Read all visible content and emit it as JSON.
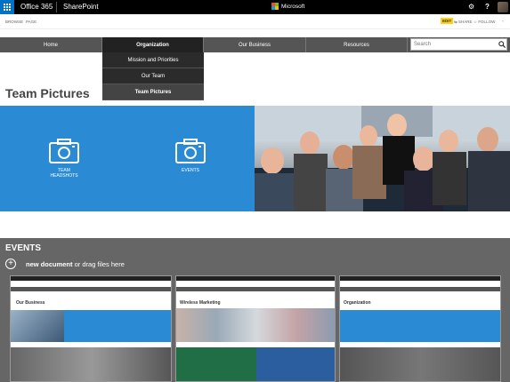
{
  "suite": {
    "app": "Office 365",
    "site": "SharePoint",
    "brand": "Microsoft"
  },
  "ribbon": {
    "browse": "BROWSE",
    "page": "PAGE",
    "edit": "EDIT",
    "share": "SHARE",
    "follow": "FOLLOW"
  },
  "nav": {
    "items": [
      "Home",
      "Organization",
      "Our Business",
      "Resources"
    ],
    "search_placeholder": "Search"
  },
  "dropdown": [
    "Mission and Priorities",
    "Our Team",
    "Team Pictures"
  ],
  "page_title": "Team Pictures",
  "tiles": [
    {
      "label_line1": "TEAM",
      "label_line2": "HEADSHOTS"
    },
    {
      "label_line1": "EVENTS",
      "label_line2": ""
    }
  ],
  "events": {
    "title": "EVENTS",
    "new_document": "new document",
    "drag_text": "or drag files here"
  },
  "thumbnails": {
    "t1_heading": "Our Business",
    "t2_heading": "Wireless Marketing",
    "t3_heading": "Organization"
  },
  "colors": {
    "accent": "#2a8ad4",
    "nav": "#555555",
    "edit": "#fcd116"
  }
}
